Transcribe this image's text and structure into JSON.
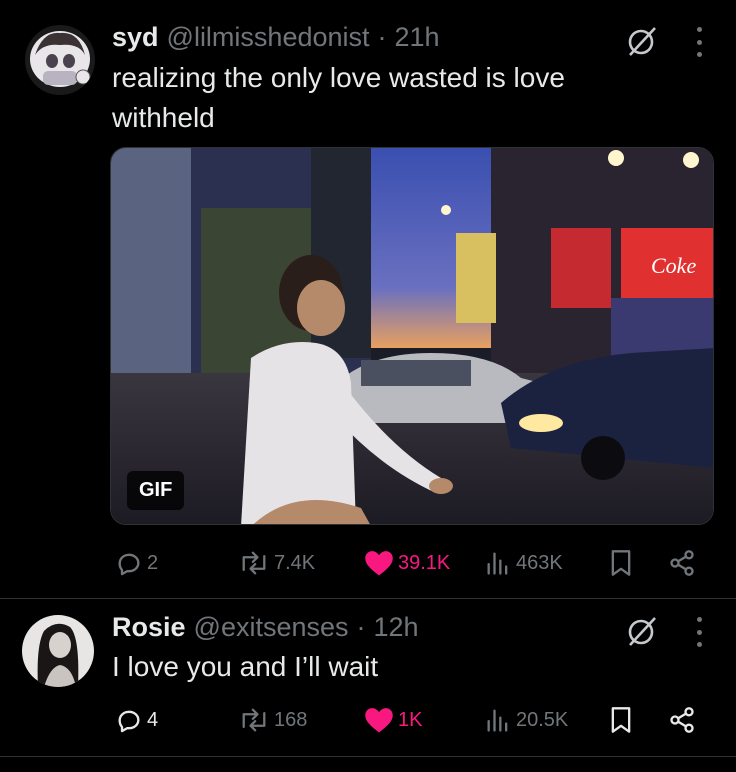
{
  "tweet1": {
    "display_name": "syd",
    "handle": "@lilmisshedonist",
    "time_sep": "·",
    "time": "21h",
    "text_line1": "realizing the only love wasted is love",
    "text_line2": "withheld",
    "media_badge": "GIF",
    "replies": "2",
    "reposts": "7.4K",
    "likes": "39.1K",
    "views": "463K"
  },
  "tweet2": {
    "display_name": "Rosie",
    "handle": "@exitsenses",
    "time_sep": "·",
    "time": "12h",
    "text": "I love you and I’ll wait",
    "replies": "4",
    "reposts": "168",
    "likes": "1K",
    "views": "20.5K"
  },
  "icons": {
    "reply": "reply-icon",
    "repost": "repost-icon",
    "like": "heart-icon",
    "views": "views-icon",
    "bookmark": "bookmark-icon",
    "share": "share-icon",
    "grok": "grok-icon",
    "more": "more-icon"
  },
  "colors": {
    "background": "#000000",
    "text": "#e7e9ea",
    "muted": "#71767b",
    "like": "#f91880"
  }
}
